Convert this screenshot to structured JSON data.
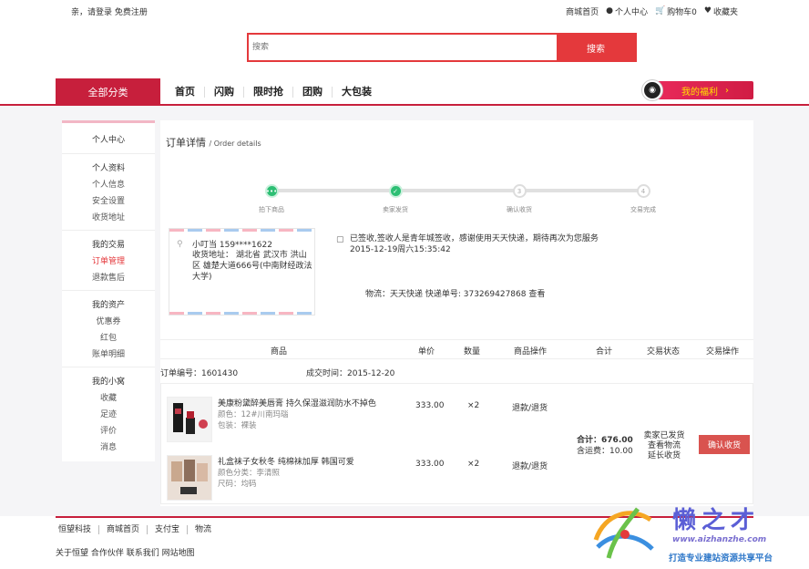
{
  "topbar": {
    "login": "亲，请登录 免费注册",
    "links": [
      {
        "icon": "",
        "label": "商城首页"
      },
      {
        "icon": "user-icon",
        "label": "个人中心"
      },
      {
        "icon": "cart-icon",
        "label": "购物车0"
      },
      {
        "icon": "heart-icon",
        "label": "收藏夹"
      }
    ]
  },
  "search": {
    "placeholder": "搜索",
    "button": "搜索"
  },
  "nav": {
    "all": "全部分类",
    "menu": [
      "首页",
      "闪购",
      "限时抢",
      "团购",
      "大包装"
    ],
    "welfare": "我的福利",
    "welfare_arrow": "›"
  },
  "sidebar": {
    "title": "个人中心",
    "groups": [
      {
        "head": "个人资料",
        "items": [
          "个人信息",
          "安全设置",
          "收货地址"
        ]
      },
      {
        "head": "我的交易",
        "items": [
          "订单管理",
          "退款售后"
        ]
      },
      {
        "head": "我的资产",
        "items": [
          "优惠券",
          "红包",
          "账单明细"
        ]
      },
      {
        "head": "我的小窝",
        "items": [
          "收藏",
          "足迹",
          "评价",
          "消息"
        ]
      }
    ],
    "active": "订单管理"
  },
  "order": {
    "title": "订单详情",
    "subtitle": "/ Order details",
    "steps": [
      {
        "label": "拍下商品",
        "mark": "•••",
        "state": "done"
      },
      {
        "label": "卖家发货",
        "mark": "✓",
        "state": "done"
      },
      {
        "label": "确认收货",
        "mark": "3",
        "state": "todo"
      },
      {
        "label": "交易完成",
        "mark": "4",
        "state": "todo"
      }
    ],
    "address": {
      "name": "小叮当 159****1622",
      "detail": "收货地址： 湖北省 武汉市 洪山区 雄楚大道666号(中南财经政法大学)"
    },
    "logistics": {
      "message": "已签收,签收人是青年城签收，感谢使用天天快递，期待再次为您服务",
      "time": "2015-12-19周六15:35:42",
      "tracking": "物流：天天快递 快递单号: 373269427868 查看"
    },
    "columns": [
      "商品",
      "单价",
      "数量",
      "商品操作",
      "合计",
      "交易状态",
      "交易操作"
    ],
    "order_no": "订单编号：1601430",
    "deal_time": "成交时间：2015-12-20",
    "products": [
      {
        "name": "美康粉黛醉美唇膏 持久保湿滋润防水不掉色",
        "attr1": "颜色：12#川南玛瑙",
        "attr2": "包装：裸装",
        "price": "333.00",
        "qty": "×2",
        "op": "退款/退货"
      },
      {
        "name": "礼盒袜子女秋冬 纯棉袜加厚 韩国可爱",
        "attr1": "颜色分类：李清照",
        "attr2": "尺码：均码",
        "price": "333.00",
        "qty": "×2",
        "op": "退款/退货"
      }
    ],
    "total": "合计：676.00",
    "shipping": "含运费：10.00",
    "status": [
      "卖家已发货",
      "查看物流",
      "延长收货"
    ],
    "confirm": "确认收货"
  },
  "footer": {
    "links": [
      "恒望科技",
      "商城首页",
      "支付宝",
      "物流"
    ],
    "about": "关于恒望 合作伙伴 联系我们 网站地图"
  },
  "watermark": {
    "title": "懒之才",
    "url": "www.aizhanzhe.com",
    "slogan": "打造专业建站资源共享平台"
  },
  "colors": {
    "brand": "#c71f3c",
    "search": "#e4393c",
    "done": "#2dbf74",
    "confirm": "#d9534f"
  }
}
